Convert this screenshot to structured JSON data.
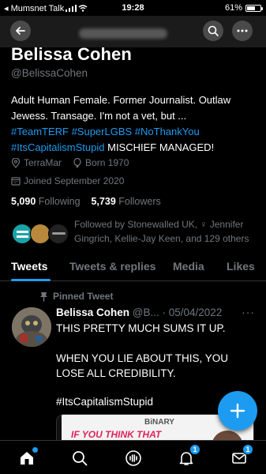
{
  "status_bar": {
    "carrier": "◂ Mumsnet Talk",
    "time": "19:28",
    "battery": "61%",
    "battery_level": 0.61
  },
  "profile": {
    "display_name": "Belissa Cohen",
    "handle": "@BelissaCohen",
    "bio_line1": "Adult Human Female. Former Journalist. Outlaw",
    "bio_line2": "Jewess. Transage. I'm not a vet, but ...",
    "bio_tags_line3": "#TeamTERF #SuperLGBS #NoThankYou",
    "bio_tag_line4": "#ItsCapitalismStupid",
    "bio_tail": " MISCHIEF MANAGED!",
    "location": "TerraMar",
    "born": "Born 1970",
    "joined": "Joined September 2020",
    "following_count": "5,090",
    "following_label": "Following",
    "followers_count": "5,739",
    "followers_label": "Followers",
    "followed_by": "Followed by Stonewalled UK, ♀ Jennifer Gingrich, Kellie-Jay Keen, and 129 others"
  },
  "tabs": [
    {
      "label": "Tweets"
    },
    {
      "label": "Tweets & replies"
    },
    {
      "label": "Media"
    },
    {
      "label": "Likes"
    }
  ],
  "tweet": {
    "pinned_label": "Pinned Tweet",
    "author": "Belissa Cohen",
    "meta": "@B... · 05/04/2022",
    "line1": "THIS PRETTY MUCH SUMS IT UP.",
    "line2": "WHEN YOU LIE ABOUT THIS, YOU",
    "line3": "LOSE ALL CREDIBILITY.",
    "hashtag": "#ItsCapitalismStupid",
    "media_top_label": "BiNARY",
    "media_headline": "IF YOU THINK THAT"
  },
  "bottom_nav": {
    "notifications_badge": "1",
    "messages_badge": "1"
  },
  "colors": {
    "accent": "#1d9bf0",
    "background": "#000000",
    "muted": "#71767b"
  },
  "icons": [
    "back-arrow-icon",
    "search-icon",
    "more-icon",
    "location-icon",
    "balloon-icon",
    "calendar-icon",
    "pin-icon",
    "compose-icon",
    "home-icon",
    "spaces-icon",
    "bell-icon",
    "mail-icon"
  ]
}
